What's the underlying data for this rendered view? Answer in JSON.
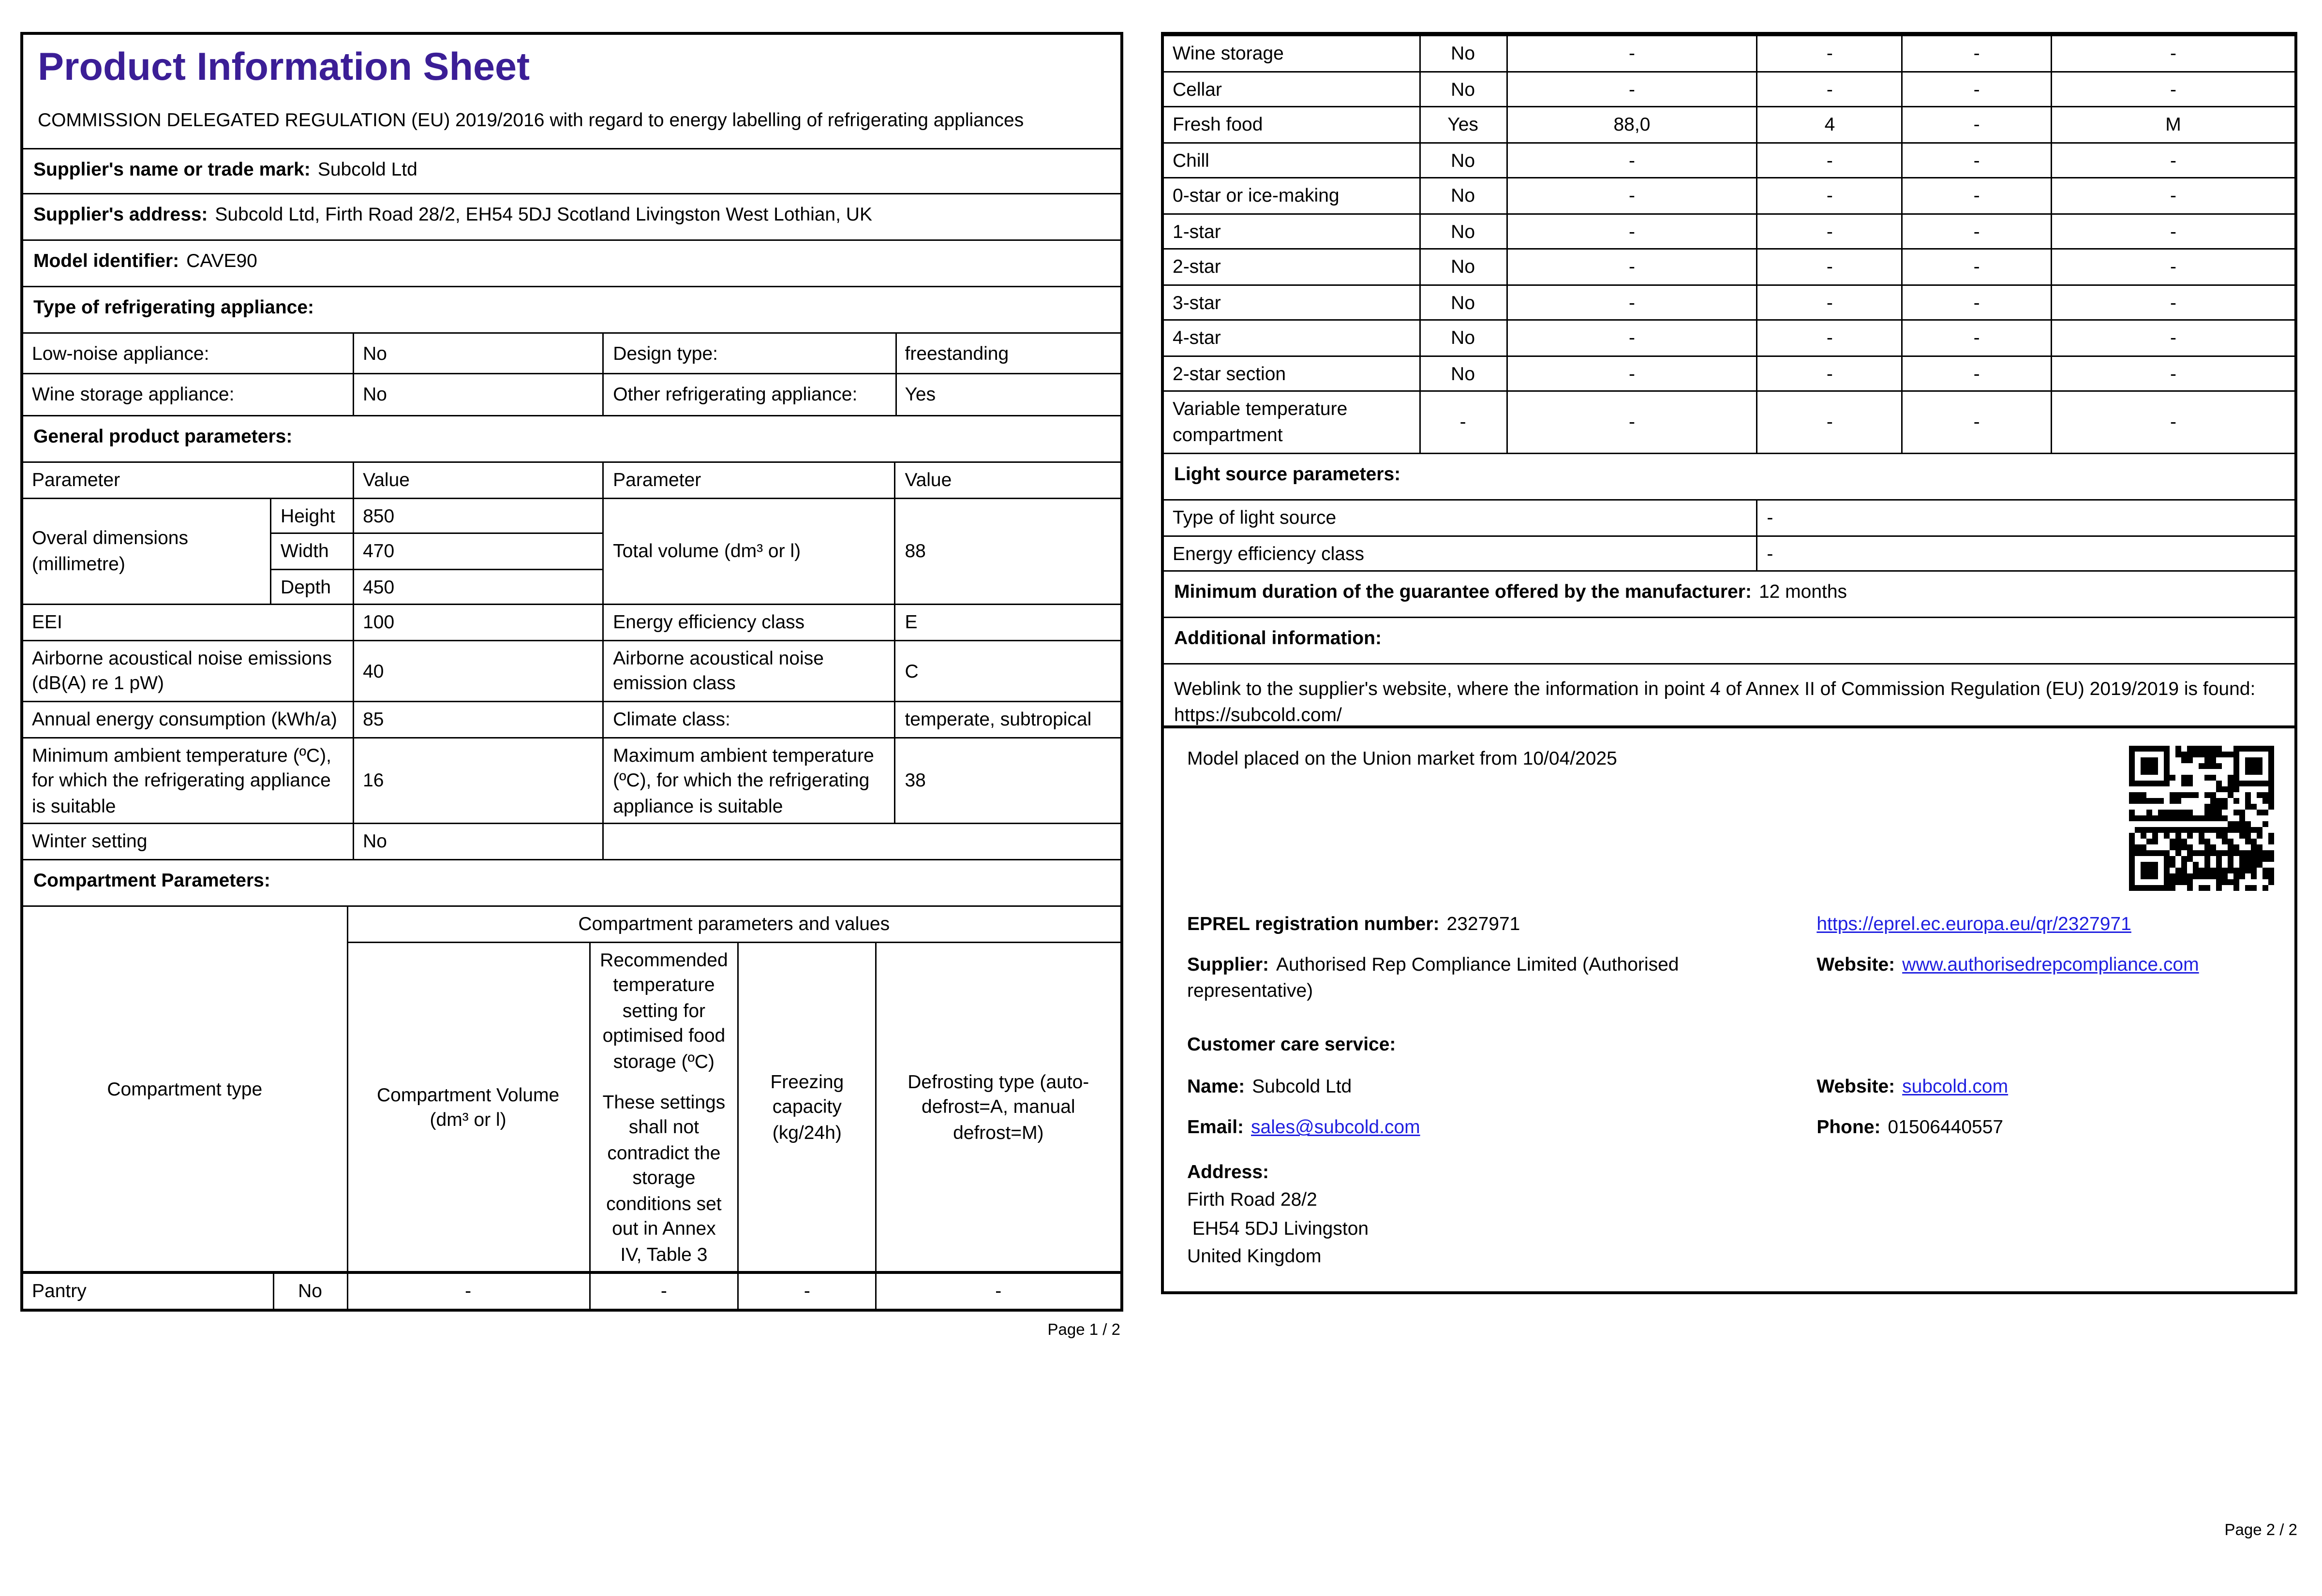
{
  "colors": {
    "title_purple": "#3B1E96",
    "link_blue": "#1F1FE0"
  },
  "page1": {
    "title": "Product Information Sheet",
    "regulation": "COMMISSION DELEGATED REGULATION (EU) 2019/2016 with regard to energy labelling of refrigerating appliances",
    "supplier_name": {
      "label": "Supplier's name or trade mark:",
      "value": "Subcold Ltd"
    },
    "supplier_address": {
      "label": "Supplier's address:",
      "value": "Subcold Ltd, Firth Road 28/2, EH54 5DJ Scotland Livingston West Lothian, UK"
    },
    "model": {
      "label": "Model identifier:",
      "value": "CAVE90"
    },
    "sections": {
      "type": "Type of refrigerating appliance:",
      "general": "General product parameters:",
      "compartment": "Compartment Parameters:"
    },
    "type_table": {
      "low_noise_label": "Low-noise appliance:",
      "low_noise_value": "No",
      "design_label": "Design type:",
      "design_value": "freestanding",
      "wine_label": "Wine storage appliance:",
      "wine_value": "No",
      "other_label": "Other refrigerating appliance:",
      "other_value": "Yes"
    },
    "gpp": {
      "headers": [
        "Parameter",
        "Value",
        "Parameter",
        "Value"
      ],
      "dimensions_label": "Overal dimensions (millimetre)",
      "height_label": "Height",
      "height_value": "850",
      "width_label": "Width",
      "width_value": "470",
      "depth_label": "Depth",
      "depth_value": "450",
      "volume_label": "Total volume (dm³ or l)",
      "volume_value": "88",
      "eei_label": "EEI",
      "eei_value": "100",
      "eec_label": "Energy efficiency class",
      "eec_value": "E",
      "noise_label": "Airborne acoustical noise emissions (dB(A) re 1 pW)",
      "noise_value": "40",
      "noise_class_label": "Airborne acoustical noise emission class",
      "noise_class_value": "C",
      "energy_label": "Annual energy consumption (kWh/a)",
      "energy_value": "85",
      "climate_label": "Climate class:",
      "climate_value": "temperate, subtropical",
      "min_temp_label": "Minimum ambient temperature (ºC), for which the refrigerating appliance is suitable",
      "min_temp_value": "16",
      "max_temp_label": "Maximum ambient temperature (ºC), for which the refrigerating appliance is suitable",
      "max_temp_value": "38",
      "winter_label": "Winter setting",
      "winter_value": "No"
    },
    "comp_table": {
      "span_header": "Compartment parameters and values",
      "type_header": "Compartment type",
      "volume_header": "Compartment Volume (dm³ or l)",
      "temp_header": "Recommended temperature setting for optimised food storage (ºC)",
      "temp_note": "These settings shall not contradict the storage conditions set out in Annex IV, Table 3",
      "freezing_header": "Freezing capacity (kg/24h)",
      "defrost_header": "Defrosting type (auto-defrost=A, manual defrost=M)",
      "pantry": {
        "name": "Pantry",
        "flag": "No",
        "volume": "-",
        "temp": "-",
        "freezing": "-",
        "defrost": "-"
      }
    },
    "footer": "Page 1 / 2"
  },
  "page2": {
    "compartment_rows": [
      {
        "name": "Wine storage",
        "flag": "No",
        "volume": "-",
        "temp": "-",
        "freezing": "-",
        "defrost": "-"
      },
      {
        "name": "Cellar",
        "flag": "No",
        "volume": "-",
        "temp": "-",
        "freezing": "-",
        "defrost": "-"
      },
      {
        "name": "Fresh food",
        "flag": "Yes",
        "volume": "88,0",
        "temp": "4",
        "freezing": "-",
        "defrost": "M"
      },
      {
        "name": "Chill",
        "flag": "No",
        "volume": "-",
        "temp": "-",
        "freezing": "-",
        "defrost": "-"
      },
      {
        "name": "0-star or ice-making",
        "flag": "No",
        "volume": "-",
        "temp": "-",
        "freezing": "-",
        "defrost": "-"
      },
      {
        "name": "1-star",
        "flag": "No",
        "volume": "-",
        "temp": "-",
        "freezing": "-",
        "defrost": "-"
      },
      {
        "name": "2-star",
        "flag": "No",
        "volume": "-",
        "temp": "-",
        "freezing": "-",
        "defrost": "-"
      },
      {
        "name": "3-star",
        "flag": "No",
        "volume": "-",
        "temp": "-",
        "freezing": "-",
        "defrost": "-"
      },
      {
        "name": "4-star",
        "flag": "No",
        "volume": "-",
        "temp": "-",
        "freezing": "-",
        "defrost": "-"
      },
      {
        "name": "2-star section",
        "flag": "No",
        "volume": "-",
        "temp": "-",
        "freezing": "-",
        "defrost": "-"
      },
      {
        "name": "Variable temperature compartment",
        "flag": "-",
        "volume": "-",
        "temp": "-",
        "freezing": "-",
        "defrost": "-"
      }
    ],
    "light_section": "Light source parameters:",
    "light_rows": [
      {
        "label": "Type of light source",
        "value": "-"
      },
      {
        "label": "Energy efficiency class",
        "value": "-"
      }
    ],
    "guarantee": {
      "label": "Minimum duration of the guarantee offered by the manufacturer:",
      "value": "12 months"
    },
    "additional_section": "Additional information:",
    "weblink": {
      "text": "Weblink to the supplier's website, where the information in point 4 of Annex II of Commission Regulation (EU) 2019/2019 is found:",
      "url": "https://subcold.com/"
    },
    "market_text": "Model placed on the Union market from 10/04/2025",
    "eprel": {
      "label": "EPREL registration number:",
      "value": "2327971",
      "link": "https://eprel.ec.europa.eu/qr/2327971"
    },
    "supplier": {
      "label": "Supplier:",
      "value": "Authorised Rep Compliance Limited (Authorised representative)",
      "website_label": "Website:",
      "website": "www.authorisedrepcompliance.com"
    },
    "care_section": "Customer care service:",
    "care": {
      "name_label": "Name:",
      "name": "Subcold Ltd",
      "website_label": "Website:",
      "website": "subcold.com",
      "email_label": "Email:",
      "email": "sales@subcold.com",
      "phone_label": "Phone:",
      "phone": "01506440557"
    },
    "address": {
      "label": "Address:",
      "lines": [
        "Firth Road 28/2",
        " EH54 5DJ Livingston",
        "United Kingdom"
      ]
    },
    "footer": "Page 2 / 2"
  }
}
